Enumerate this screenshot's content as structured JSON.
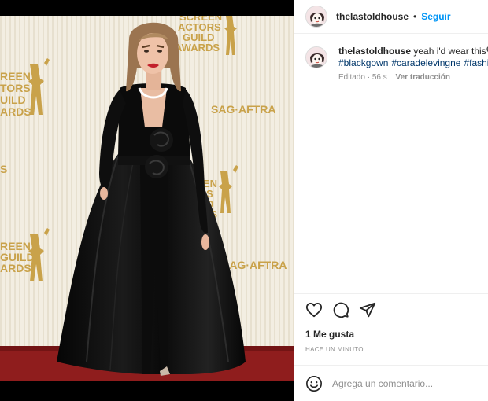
{
  "post": {
    "username": "thelastoldhouse",
    "separator": "•",
    "follow_label": "Seguir"
  },
  "caption": {
    "username": "thelastoldhouse",
    "text": "yeah i'd wear this🖤",
    "hashtags": [
      "#blackgown",
      "#caradelevingne",
      "#fashion"
    ],
    "edited_label": "Editado",
    "time": "56 s",
    "translate_label": "Ver traducción"
  },
  "photo": {
    "backdrop_logos": [
      "SCREEN ACTORS GUILD AWARDS",
      "SAG-AFTRA"
    ],
    "banner_text": {
      "top": [
        "SCREEN",
        "ACTORS",
        "GUILD",
        "AWARDS"
      ],
      "left": [
        "REEN",
        "TORS",
        "UILD",
        "ARDS"
      ],
      "mid": [
        "EN",
        "S",
        "D",
        "DS"
      ],
      "lower": [
        "REEN",
        "GUILD",
        "ARDS"
      ],
      "sag": "SAG·AFTRA"
    }
  },
  "actions": {
    "icons": [
      "heart-icon",
      "comment-icon",
      "share-icon"
    ],
    "likes_label": "1 Me gusta",
    "time_ago": "HACE UN MINUTO"
  },
  "comment": {
    "placeholder": "Agrega un comentario..."
  },
  "colors": {
    "follow_blue": "#0095f6",
    "hashtag_blue": "#00376b",
    "muted": "#8e8e8e",
    "gold": "#c9a24a",
    "carpet_red": "#8f1d1d"
  }
}
